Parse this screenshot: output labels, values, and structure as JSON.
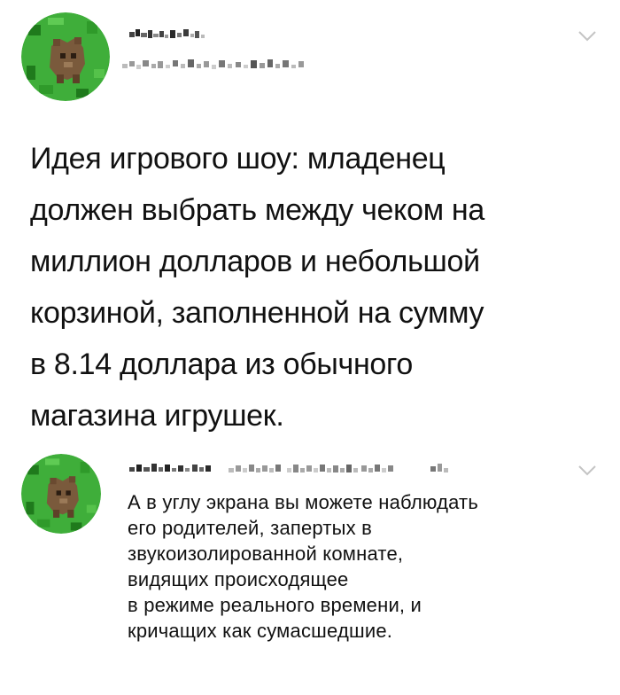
{
  "main_tweet": {
    "text_lines": [
      "Идея игрового шоу: младенец",
      "должен выбрать между чеком на",
      "миллион долларов и небольшой",
      "корзиной, заполненной на сумму",
      "в 8.14 доллара из обычного",
      "магазина игрушек."
    ],
    "avatar_icon": "bear-avatar-icon",
    "menu_icon": "chevron-down-icon"
  },
  "reply_tweet": {
    "text_lines": [
      "А в углу экрана вы можете наблюдать",
      "его родителей, запертых в",
      "звукоизолированной комнате,",
      "видящих происходящее",
      "в режиме реального времени, и",
      "кричащих как сумасшедшие."
    ],
    "avatar_icon": "bear-avatar-icon",
    "menu_icon": "chevron-down-icon"
  },
  "colors": {
    "avatar_green": "#3fae3a",
    "avatar_dark_green": "#1f7a1c",
    "bear_brown": "#7a5a3c",
    "chevron_gray": "#c4c4c4",
    "text": "#111111"
  }
}
